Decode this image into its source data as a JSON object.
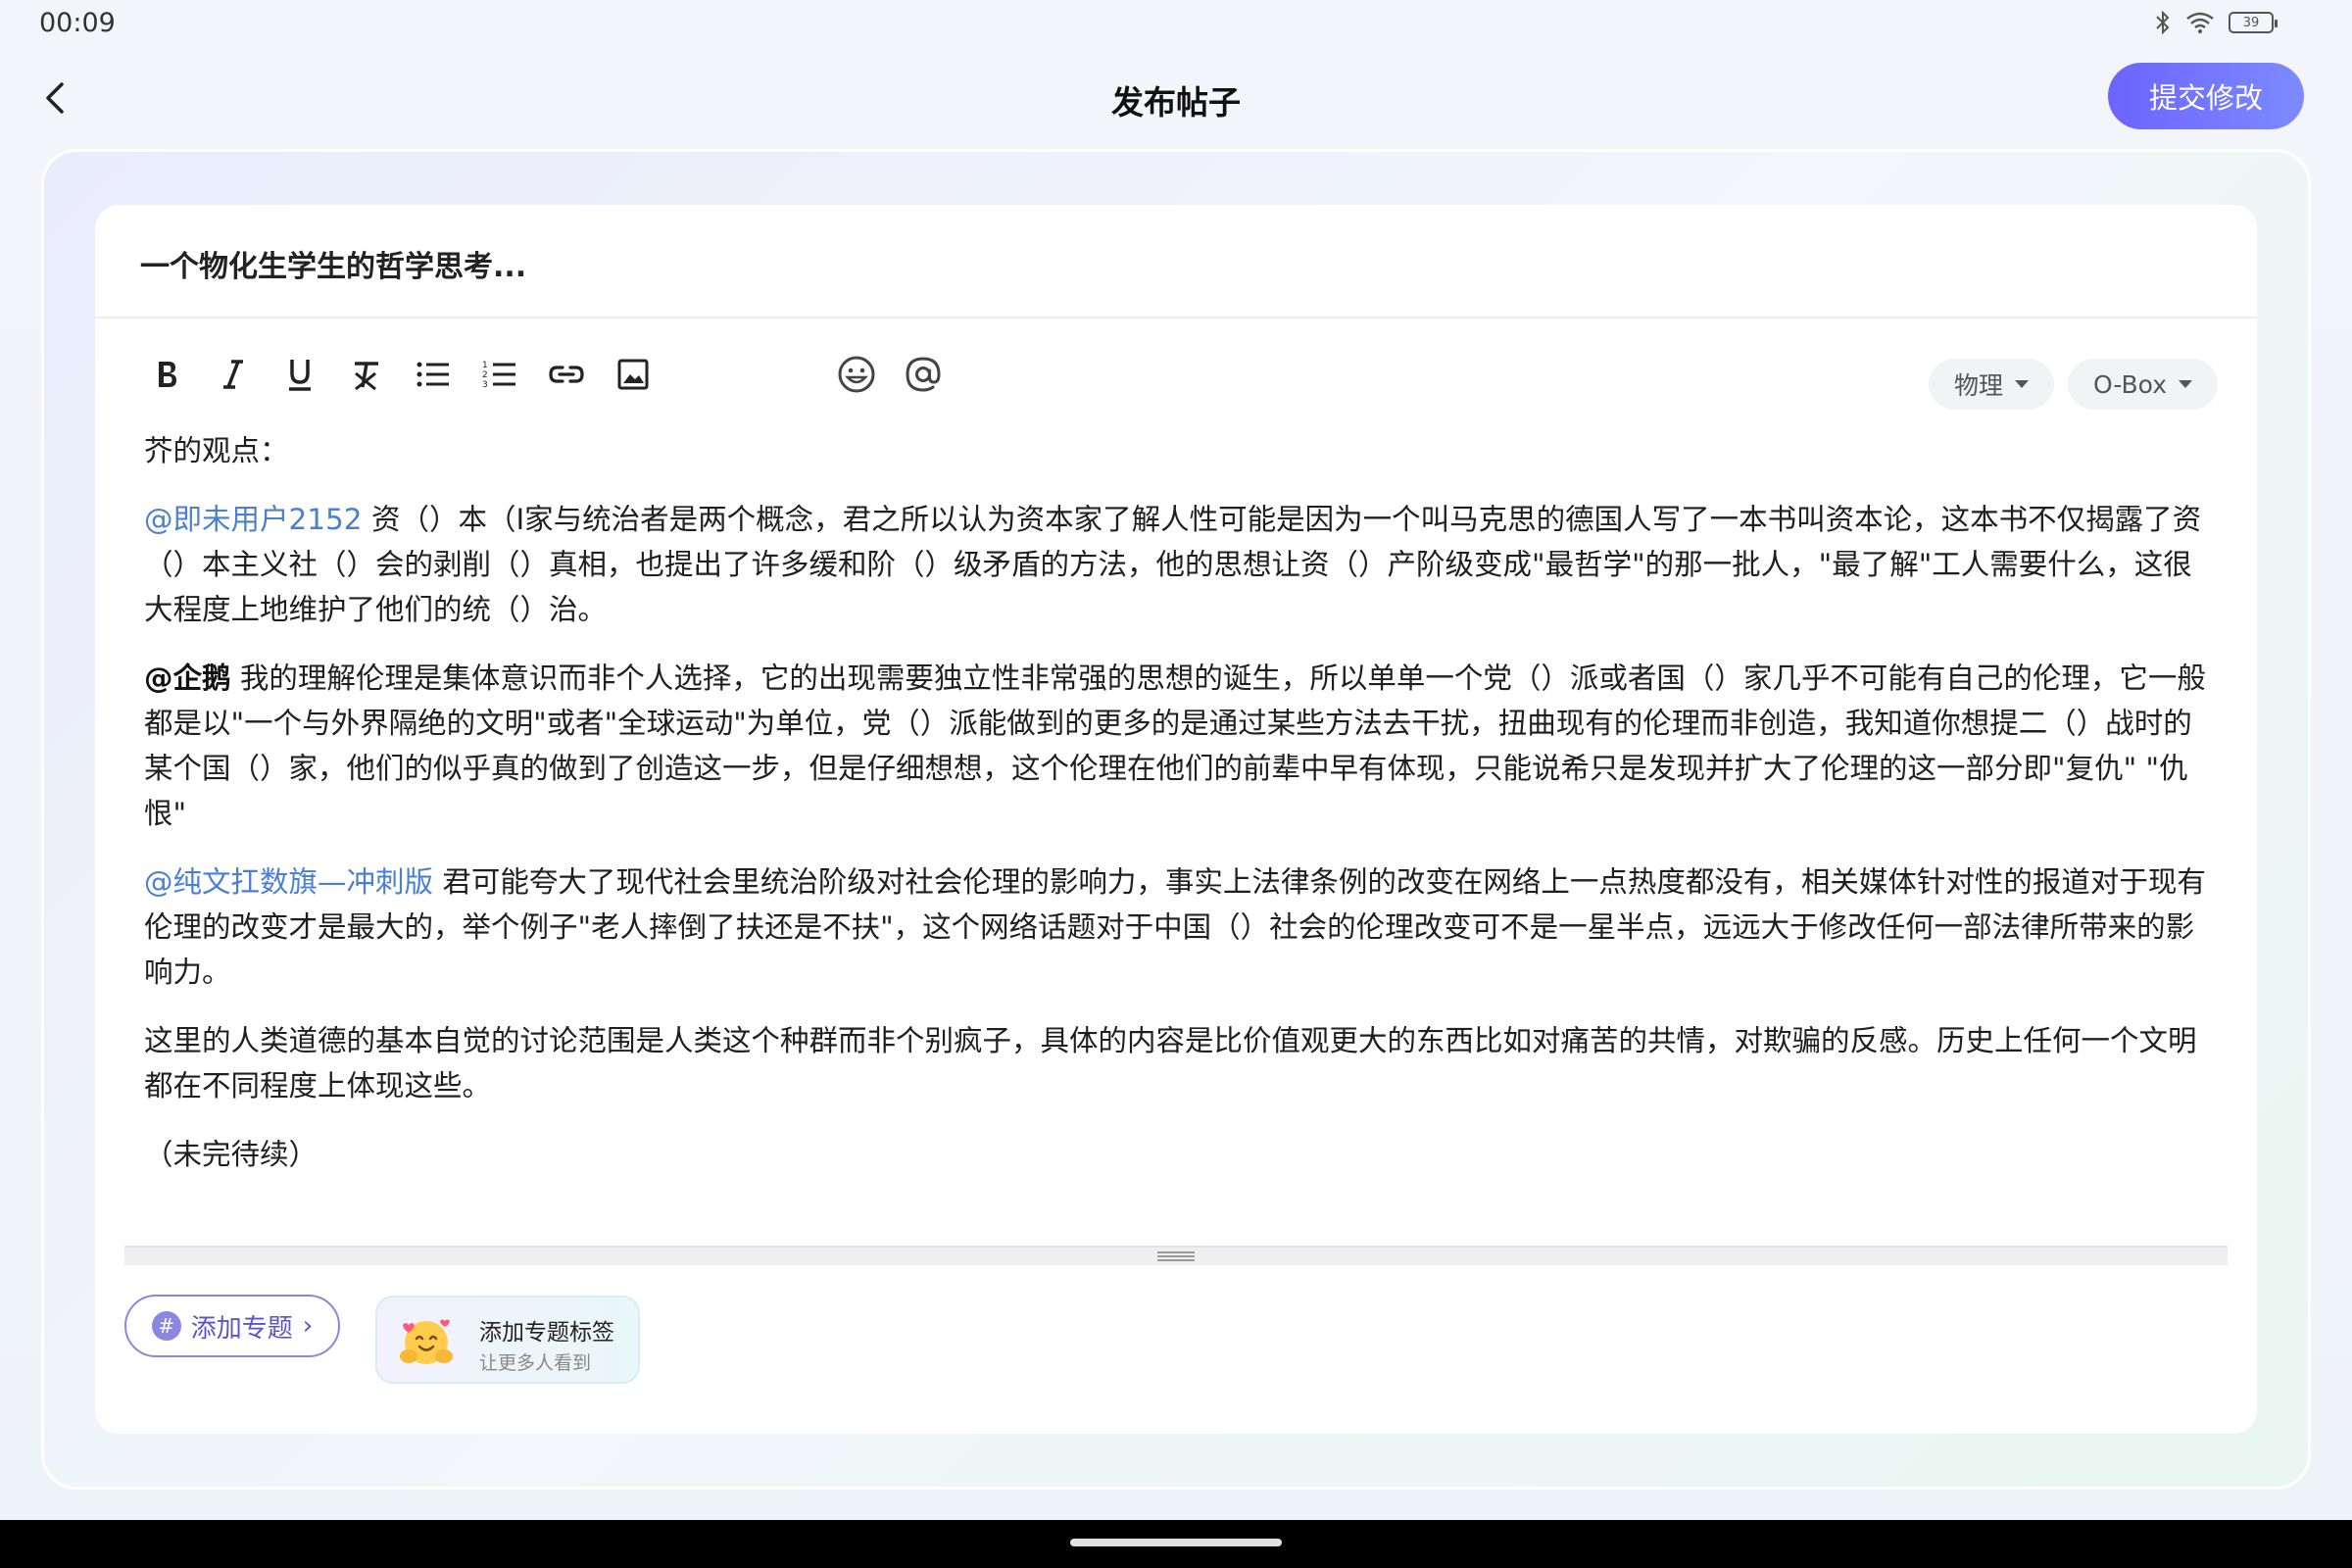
{
  "status": {
    "time": "00:09",
    "battery": "39"
  },
  "header": {
    "title": "发布帖子",
    "submit_label": "提交修改"
  },
  "post": {
    "title": "一个物化生学生的哲学思考..."
  },
  "selectors": [
    {
      "label": "物理"
    },
    {
      "label": "O-Box"
    }
  ],
  "editor": {
    "intro": "芥的观点：",
    "p1_mention": "@即未用户2152",
    "p1_text": " 资（）本（I家与统治者是两个概念，君之所以认为资本家了解人性可能是因为一个叫马克思的德国人写了一本书叫资本论，这本书不仅揭露了资（）本主义社（）会的剥削（）真相，也提出了许多缓和阶（）级矛盾的方法，他的思想让资（）产阶级变成\"最哲学\"的那一批人，\"最了解\"工人需要什么，这很大程度上地维护了他们的统（）治。",
    "p2_mention": "@企鹅",
    "p2_text": " 我的理解伦理是集体意识而非个人选择，它的出现需要独立性非常强的思想的诞生，所以单单一个党（）派或者国（）家几乎不可能有自己的伦理，它一般都是以\"一个与外界隔绝的文明\"或者\"全球运动\"为单位，党（）派能做到的更多的是通过某些方法去干扰，扭曲现有的伦理而非创造，我知道你想提二（）战时的某个国（）家，他们的似乎真的做到了创造这一步，但是仔细想想，这个伦理在他们的前辈中早有体现，只能说希只是发现并扩大了伦理的这一部分即\"复仇\" \"仇恨\"",
    "p3_mention": "@纯文扛数旗—冲刺版",
    "p3_text": " 君可能夸大了现代社会里统治阶级对社会伦理的影响力，事实上法律条例的改变在网络上一点热度都没有，相关媒体针对性的报道对于现有伦理的改变才是最大的，举个例子\"老人摔倒了扶还是不扶\"，这个网络话题对于中国（）社会的伦理改变可不是一星半点，远远大于修改任何一部法律所带来的影响力。",
    "p4_text": "这里的人类道德的基本自觉的讨论范围是人类这个种群而非个别疯子，具体的内容是比价值观更大的东西比如对痛苦的共情，对欺骗的反感。历史上任何一个文明都在不同程度上体现这些。",
    "p5_text": "（未完待续）"
  },
  "topic": {
    "add_label": "添加专题",
    "hash": "#",
    "chevron": "›"
  },
  "tip": {
    "title": "添加专题标签",
    "subtitle": "让更多人看到"
  },
  "colors": {
    "accent": "#6c63ff",
    "mention": "#4a7fd4"
  }
}
